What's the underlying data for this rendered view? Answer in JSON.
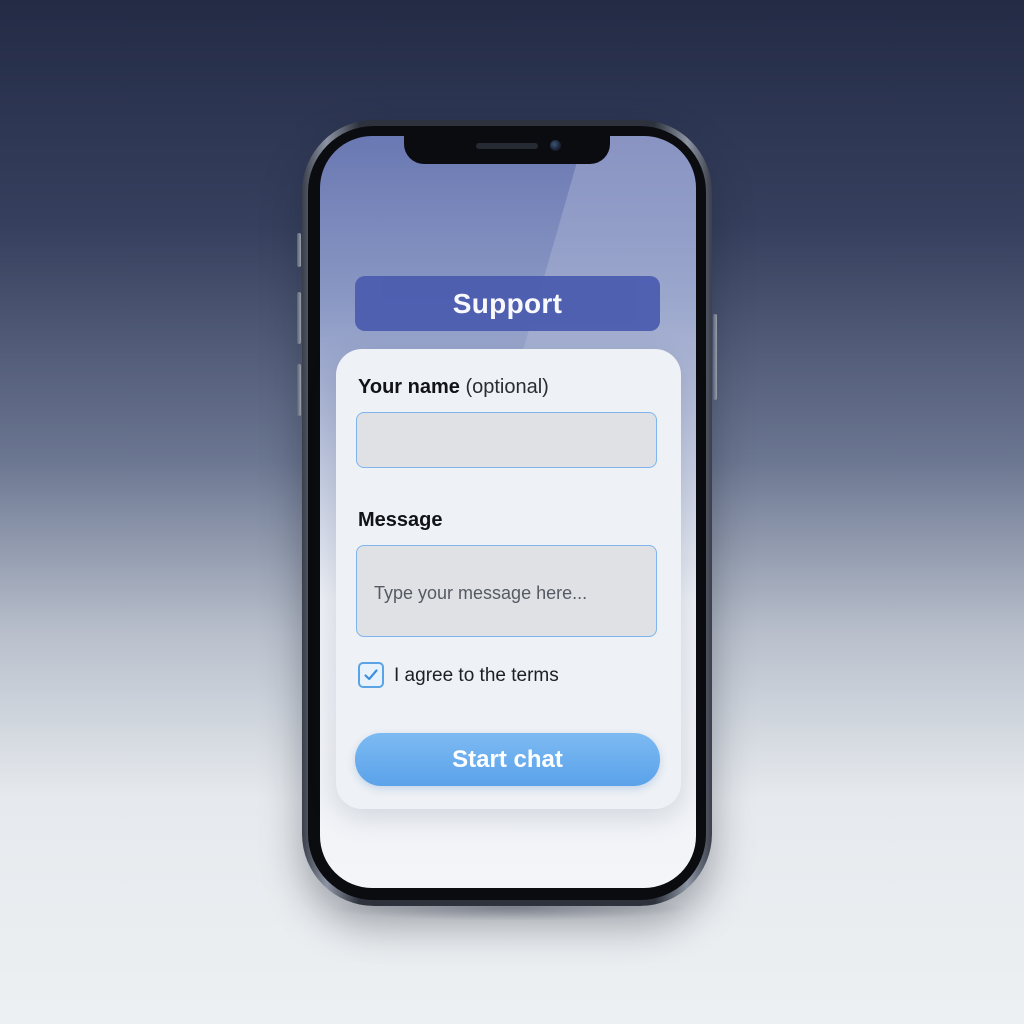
{
  "header": {
    "title": "Support"
  },
  "form": {
    "name_label": "Your name",
    "name_label_hint": "(optional)",
    "name_value": "",
    "message_label": "Message",
    "message_placeholder": "Type your message here...",
    "terms_label": "I agree to the terms",
    "terms_checked": true,
    "submit_label": "Start chat"
  },
  "colors": {
    "header_bg": "#4c5db0",
    "accent": "#5aa2ea",
    "input_border": "#7fb5ec"
  },
  "icons": {
    "checkbox": "checkmark-icon"
  }
}
